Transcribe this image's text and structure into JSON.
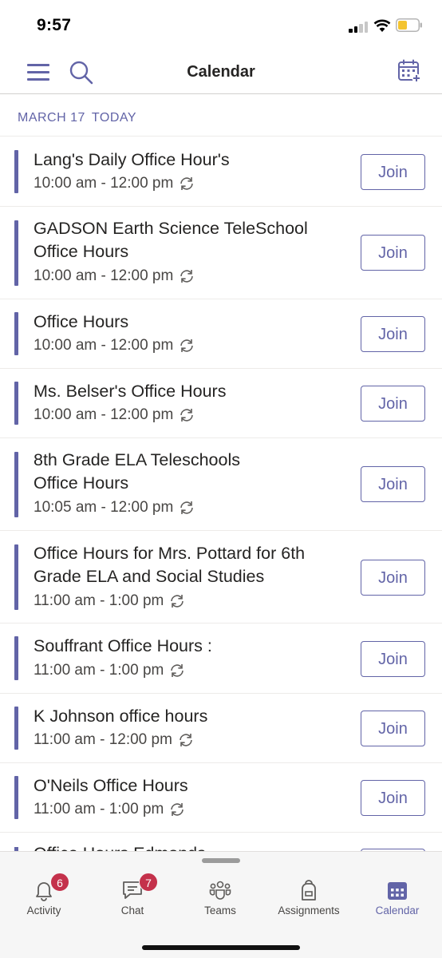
{
  "status_bar": {
    "time": "9:57"
  },
  "header": {
    "title": "Calendar",
    "menu_icon": "hamburger-menu-icon",
    "search_icon": "search-icon",
    "add_icon": "calendar-add-icon"
  },
  "date_section": {
    "date": "MARCH 17",
    "today": "TODAY"
  },
  "events": [
    {
      "title": "Lang's Daily Office Hour's",
      "time": "10:00 am - 12:00 pm",
      "recurring": true,
      "join_label": "Join"
    },
    {
      "title": "GADSON  Earth Science TeleSchool Office Hours",
      "time": "10:00 am - 12:00 pm",
      "recurring": true,
      "join_label": "Join"
    },
    {
      "title": "Office Hours",
      "time": "10:00 am - 12:00 pm",
      "recurring": true,
      "join_label": "Join"
    },
    {
      "title": "Ms. Belser's Office Hours",
      "time": "10:00 am - 12:00 pm",
      "recurring": true,
      "join_label": "Join"
    },
    {
      "title": "8th Grade ELA Teleschools Office Hours",
      "time": "10:05 am - 12:00 pm",
      "recurring": true,
      "join_label": "Join"
    },
    {
      "title": "Office Hours for Mrs. Pottard for 6th Grade ELA and Social Studies",
      "time": "11:00 am - 1:00 pm",
      "recurring": true,
      "join_label": "Join"
    },
    {
      "title": "Souffrant Office Hours :",
      "time": "11:00 am - 1:00 pm",
      "recurring": true,
      "join_label": "Join"
    },
    {
      "title": "K Johnson office hours",
      "time": "11:00 am - 12:00 pm",
      "recurring": true,
      "join_label": "Join"
    },
    {
      "title": "O'Neils Office Hours",
      "time": "11:00 am - 1:00 pm",
      "recurring": true,
      "join_label": "Join"
    }
  ],
  "partial_event": {
    "title": "Office Hours Edmonds"
  },
  "tabs": [
    {
      "label": "Activity",
      "icon": "bell-icon",
      "badge": "6",
      "active": false
    },
    {
      "label": "Chat",
      "icon": "chat-icon",
      "badge": "7",
      "active": false
    },
    {
      "label": "Teams",
      "icon": "teams-icon",
      "badge": "",
      "active": false
    },
    {
      "label": "Assignments",
      "icon": "backpack-icon",
      "badge": "",
      "active": false
    },
    {
      "label": "Calendar",
      "icon": "calendar-icon",
      "badge": "",
      "active": true
    }
  ],
  "colors": {
    "accent": "#6264a7",
    "badge": "#c4314b",
    "text": "#252423",
    "secondary_text": "#484644"
  }
}
